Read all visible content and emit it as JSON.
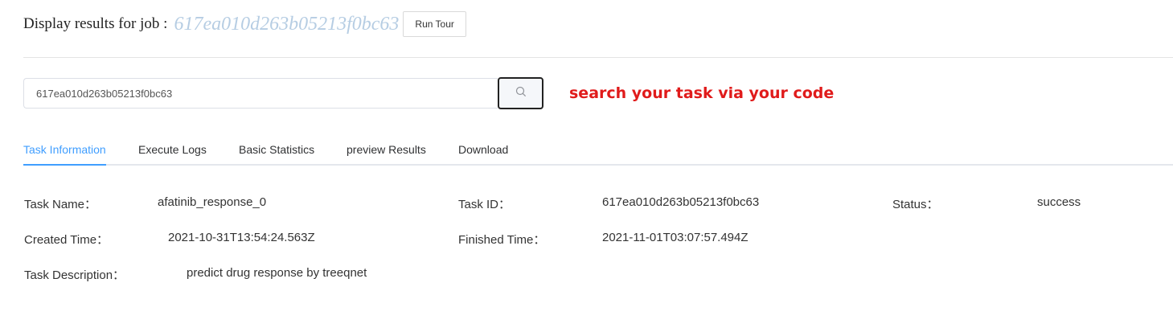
{
  "header": {
    "label": "Display results for job :",
    "job_id": "617ea010d263b05213f0bc63",
    "run_tour_label": "Run Tour"
  },
  "search": {
    "value": "617ea010d263b05213f0bc63",
    "icon": "search-icon",
    "hint": "search your task via your code"
  },
  "tabs": [
    {
      "label": "Task Information",
      "active": true
    },
    {
      "label": "Execute Logs",
      "active": false
    },
    {
      "label": "Basic Statistics",
      "active": false
    },
    {
      "label": "preview Results",
      "active": false
    },
    {
      "label": "Download",
      "active": false
    }
  ],
  "colors": {
    "tab_active": "#409eff",
    "hint": "#e01b1b",
    "job_id": "#b6cde3"
  },
  "task_info": {
    "name_label": "Task Name：",
    "name_value": "afatinib_response_0",
    "id_label": "Task ID：",
    "id_value": "617ea010d263b05213f0bc63",
    "status_label": "Status：",
    "status_value": "success",
    "created_label": "Created Time：",
    "created_value": "2021-10-31T13:54:24.563Z",
    "finished_label": "Finished Time：",
    "finished_value": "2021-11-01T03:07:57.494Z",
    "description_label": "Task Description：",
    "description_value": "predict drug response by treeqnet"
  }
}
